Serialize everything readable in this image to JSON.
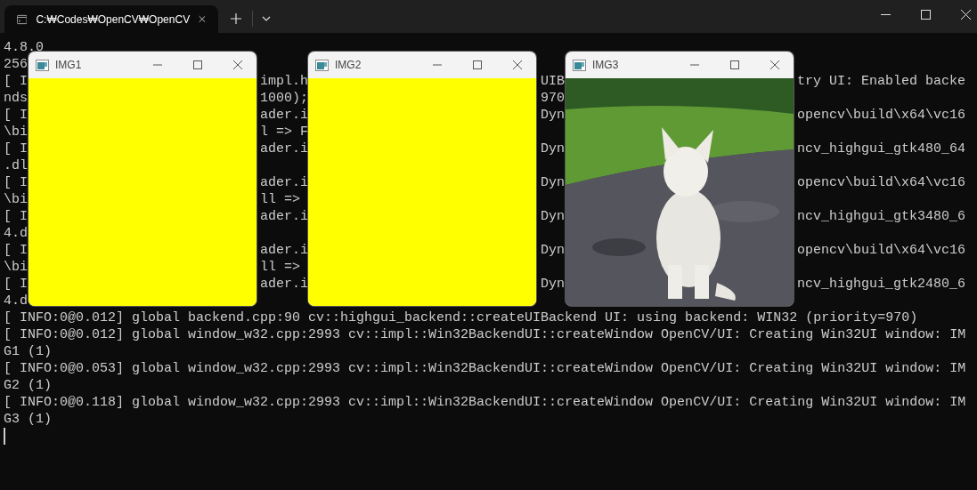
{
  "window": {
    "tab": {
      "title": "C:₩Codes₩OpenCV₩OpenCV",
      "selected": true
    }
  },
  "terminal": {
    "top_lines": [
      "4.8.0",
      "256"
    ],
    "overlaid_rows": [
      {
        "left": "[ I",
        "gap1": "impl.h",
        "gap2": "UIB",
        "right": "try UI: Enabled backe"
      },
      {
        "left": "nds",
        "gap1": "1000);",
        "gap2": "970"
      },
      {
        "left": "[ I",
        "gap1": "ader.i",
        "gap2": "Dyn",
        "right": "opencv\\build\\x64\\vc16"
      },
      {
        "left": "\\bi",
        "gap1": "l => F"
      },
      {
        "left": "[ I",
        "gap1": "ader.i",
        "gap2": "Dyn",
        "right": "ncv_highgui_gtk480_64"
      },
      {
        "left": ".dl"
      },
      {
        "left": "[ I",
        "gap1": "ader.i",
        "gap2": "Dyn",
        "right": "opencv\\build\\x64\\vc16"
      },
      {
        "left": "\\bi",
        "gap1": "ll =>"
      },
      {
        "left": "[ I",
        "gap1": "ader.i",
        "gap2": "Dyn",
        "right": "ncv_highgui_gtk3480_6"
      },
      {
        "left": "4.d"
      },
      {
        "left": "[ I",
        "gap1": "ader.i",
        "gap2": "Dyn",
        "right": "opencv\\build\\x64\\vc16"
      },
      {
        "left": "\\bi",
        "gap1": "ll =>"
      },
      {
        "left": "[ I",
        "gap1": "ader.i",
        "gap2": "Dyn",
        "right": "ncv_highgui_gtk2480_6"
      },
      {
        "left": "4.d"
      }
    ],
    "lines": [
      "[ INFO:0@0.012] global backend.cpp:90 cv::highgui_backend::createUIBackend UI: using backend: WIN32 (priority=970)",
      "[ INFO:0@0.012] global window_w32.cpp:2993 cv::impl::Win32BackendUI::createWindow OpenCV/UI: Creating Win32UI window: IM",
      "G1 (1)",
      "[ INFO:0@0.053] global window_w32.cpp:2993 cv::impl::Win32BackendUI::createWindow OpenCV/UI: Creating Win32UI window: IM",
      "G2 (1)",
      "[ INFO:0@0.118] global window_w32.cpp:2993 cv::impl::Win32BackendUI::createWindow OpenCV/UI: Creating Win32UI window: IM",
      "G3 (1)"
    ]
  },
  "image_windows": [
    {
      "title": "IMG1",
      "kind": "solid"
    },
    {
      "title": "IMG2",
      "kind": "solid"
    },
    {
      "title": "IMG3",
      "kind": "picture"
    }
  ]
}
